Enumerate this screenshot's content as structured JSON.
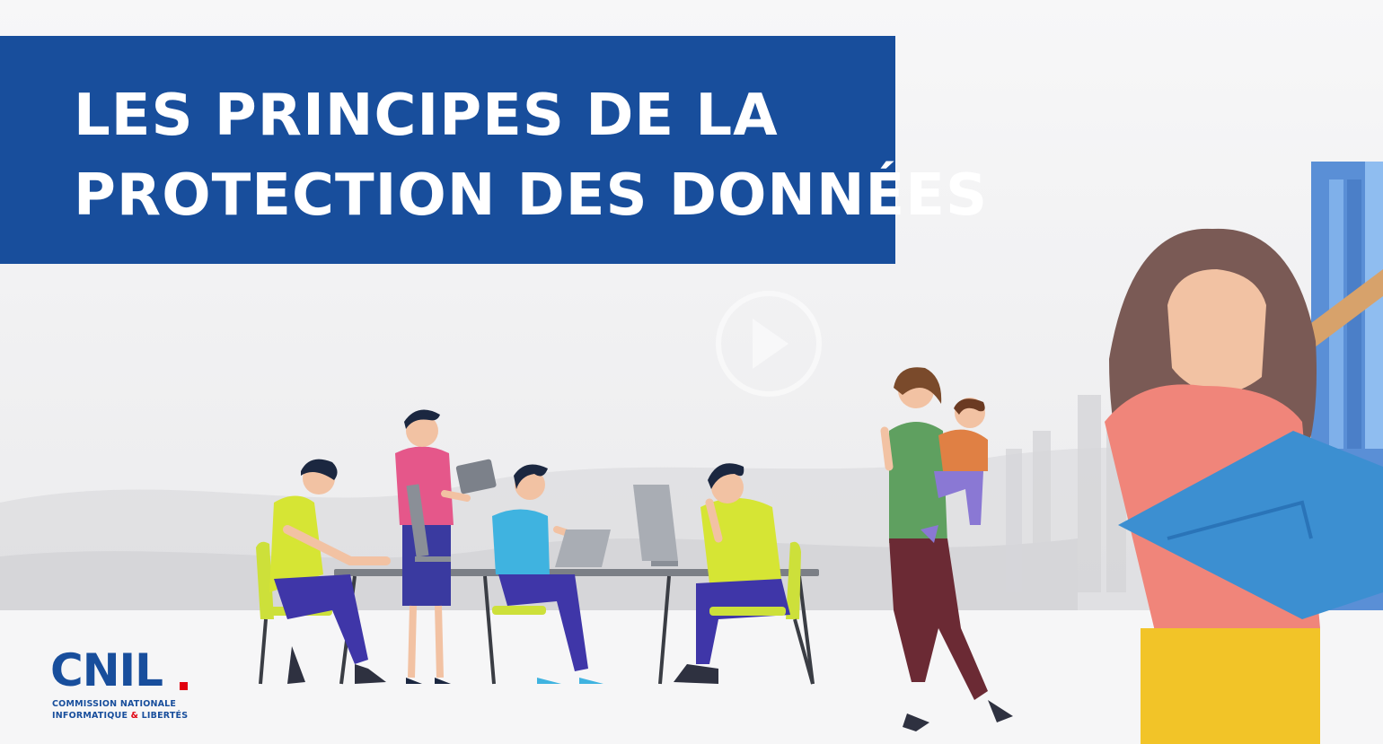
{
  "title": {
    "line1": "LES PRINCIPES DE LA",
    "line2": "PROTECTION DES DONNÉES"
  },
  "logo": {
    "wordmark": "CNIL",
    "subtitle_line1": "COMMISSION NATIONALE",
    "subtitle_line2_a": "INFORMATIQUE",
    "subtitle_line2_amp": "&",
    "subtitle_line2_b": "LIBERTÉS"
  },
  "colors": {
    "banner": "#184e9c",
    "brand_red": "#e1000f",
    "background": "#f3f3f4"
  },
  "icons": [
    "play-icon"
  ]
}
